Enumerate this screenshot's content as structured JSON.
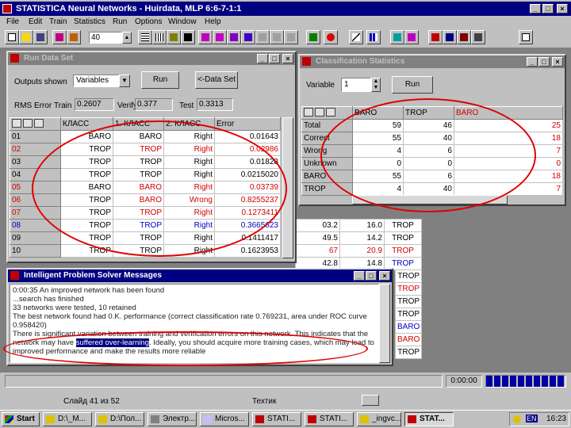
{
  "app": {
    "title": "STATISTICA Neural Networks - Huirdata, MLP 6:6-7-1:1"
  },
  "menu": [
    "File",
    "Edit",
    "Train",
    "Statistics",
    "Run",
    "Options",
    "Window",
    "Help"
  ],
  "toolbar": {
    "number_value": "40"
  },
  "run_data_set": {
    "title": "Run Data Set",
    "outputs_label": "Outputs shown",
    "outputs_value": "Variables",
    "run_label": "Run",
    "data_set_label": "<-Data Set",
    "rms_label": "RMS Error",
    "train_label": "Train",
    "train_value": "0.2607",
    "verify_label": "Verify",
    "verify_value": "0.377",
    "test_label": "Test",
    "test_value": "0.3313",
    "columns": [
      "КЛАСС",
      "1. КЛАСС",
      "2. КЛАСС",
      "Error"
    ],
    "rows": [
      {
        "id": "01",
        "a": "BARO",
        "b": "BARO",
        "c": "Right",
        "err": "0.01643",
        "color": "black"
      },
      {
        "id": "02",
        "a": "TROP",
        "b": "TROP",
        "c": "Right",
        "err": "0.02986",
        "color": "red"
      },
      {
        "id": "03",
        "a": "TROP",
        "b": "TROP",
        "c": "Right",
        "err": "0.01828",
        "color": "black"
      },
      {
        "id": "04",
        "a": "TROP",
        "b": "TROP",
        "c": "Right",
        "err": "0.0215020",
        "color": "black"
      },
      {
        "id": "05",
        "a": "BARO",
        "b": "BARO",
        "c": "Right",
        "err": "0.03739",
        "color": "red"
      },
      {
        "id": "06",
        "a": "TROP",
        "b": "BARO",
        "c": "Wrong",
        "err": "0.8255237",
        "color": "red"
      },
      {
        "id": "07",
        "a": "TROP",
        "b": "TROP",
        "c": "Right",
        "err": "0.1273411",
        "color": "red"
      },
      {
        "id": "08",
        "a": "TROP",
        "b": "TROP",
        "c": "Right",
        "err": "0.3665623",
        "color": "blue"
      },
      {
        "id": "09",
        "a": "TROP",
        "b": "TROP",
        "c": "Right",
        "err": "0.1411417",
        "color": "black"
      },
      {
        "id": "10",
        "a": "TROP",
        "b": "TROP",
        "c": "Right",
        "err": "0.1623953",
        "color": "black"
      }
    ]
  },
  "classification": {
    "title": "Classification Statistics",
    "variable_label": "Variable",
    "variable_value": "1",
    "run_label": "Run",
    "columns": [
      "BARO",
      "TROP",
      "BARO"
    ],
    "rows": [
      {
        "label": "Total",
        "v": [
          "59",
          "46",
          "25"
        ]
      },
      {
        "label": "Correct",
        "v": [
          "55",
          "40",
          "18"
        ]
      },
      {
        "label": "Wrong",
        "v": [
          "4",
          "6",
          "7"
        ]
      },
      {
        "label": "Unknown",
        "v": [
          "0",
          "0",
          "0"
        ]
      },
      {
        "label": "BARO",
        "v": [
          "55",
          "6",
          "18"
        ]
      },
      {
        "label": "TROP",
        "v": [
          "4",
          "40",
          "7"
        ]
      }
    ]
  },
  "background_grid": {
    "rows": [
      {
        "a": "03.2",
        "b": "16.0",
        "c": "TROP"
      },
      {
        "a": "49.5",
        "b": "14.2",
        "c": "TROP"
      },
      {
        "a": "67",
        "b": "20.9",
        "c": "TROP"
      },
      {
        "a": "42.8",
        "b": "14.8",
        "c": "TROP"
      }
    ],
    "side_column": [
      "TROP",
      "TROP",
      "TROP",
      "TROP",
      "TROP",
      "BARO",
      "BARO",
      "TROP",
      "TROP"
    ]
  },
  "ips": {
    "title": "Intelligent Problem Solver Messages",
    "lines": [
      "0:00:35 An improved network has been found",
      "...search has finished",
      "33 networks were tested, 10 retained",
      "The best network found had 0.K. performance (correct classification rate 0.769231, area under ROC curve",
      "0.958420)",
      "There is significant variation between training and verification errors on this network. This indicates that the",
      "network may have ",
      "suffered over-learning",
      ". Ideally, you should acquire more training cases, which may lead to",
      "improved performance and make the results more reliable"
    ]
  },
  "status": {
    "time": "0:00:00"
  },
  "pres_status": {
    "slide": "Слайд 41 из 52",
    "template": "Техтик"
  },
  "taskbar": {
    "start": "Start",
    "items": [
      "D:\\_M...",
      "D:\\Пол...",
      "Электр...",
      "Micros...",
      "STATI...",
      "STATI...",
      "_ingvc...",
      "STAT..."
    ],
    "lang": "EN",
    "clock": "16:23"
  },
  "colors": {
    "accent": "#000080",
    "annotation": "#e00000"
  }
}
